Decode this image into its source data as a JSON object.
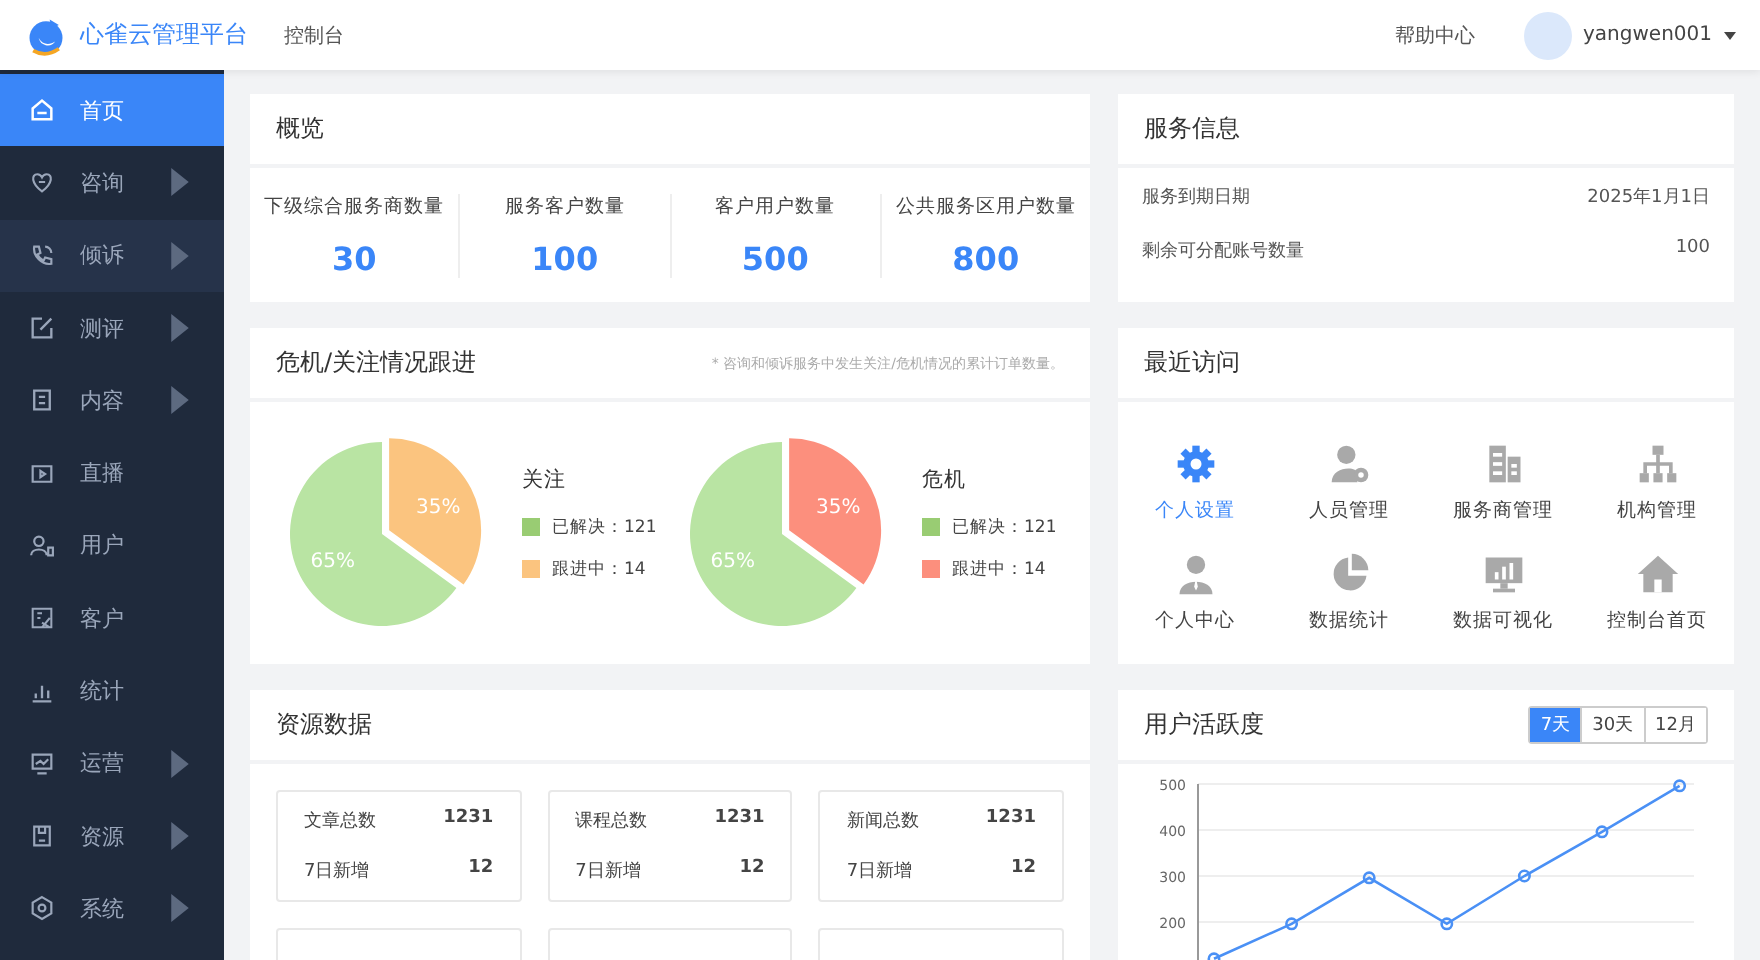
{
  "header": {
    "brand": "心雀云管理平台",
    "section": "控制台",
    "help": "帮助中心",
    "username": "yangwen001"
  },
  "sidebar": {
    "items": [
      {
        "label": "首页",
        "selected": true,
        "hovered": false,
        "has_submenu": false
      },
      {
        "label": "咨询",
        "selected": false,
        "hovered": false,
        "has_submenu": true
      },
      {
        "label": "倾诉",
        "selected": false,
        "hovered": true,
        "has_submenu": true
      },
      {
        "label": "测评",
        "selected": false,
        "hovered": false,
        "has_submenu": true
      },
      {
        "label": "内容",
        "selected": false,
        "hovered": false,
        "has_submenu": true
      },
      {
        "label": "直播",
        "selected": false,
        "hovered": false,
        "has_submenu": false
      },
      {
        "label": "用户",
        "selected": false,
        "hovered": false,
        "has_submenu": false
      },
      {
        "label": "客户",
        "selected": false,
        "hovered": false,
        "has_submenu": false
      },
      {
        "label": "统计",
        "selected": false,
        "hovered": false,
        "has_submenu": false
      },
      {
        "label": "运营",
        "selected": false,
        "hovered": false,
        "has_submenu": true
      },
      {
        "label": "资源",
        "selected": false,
        "hovered": false,
        "has_submenu": true
      },
      {
        "label": "系统",
        "selected": false,
        "hovered": false,
        "has_submenu": true
      }
    ]
  },
  "overview": {
    "title": "概览",
    "stats": [
      {
        "label": "下级综合服务商数量",
        "value": "30"
      },
      {
        "label": "服务客户数量",
        "value": "100"
      },
      {
        "label": "客户用户数量",
        "value": "500"
      },
      {
        "label": "公共服务区用户数量",
        "value": "800"
      }
    ]
  },
  "service_info": {
    "title": "服务信息",
    "rows": [
      {
        "label": "服务到期日期",
        "value": "2025年1月1日"
      },
      {
        "label": "剩余可分配账号数量",
        "value": "100"
      }
    ]
  },
  "crisis": {
    "title": "危机/关注情况跟进",
    "note": "* 咨询和倾诉服务中发生关注/危机情况的累计订单数量。",
    "pies": [
      {
        "title": "关注",
        "slices": [
          {
            "pct": "65%",
            "color": "#b9e4a3"
          },
          {
            "pct": "35%",
            "color": "#fbc47f"
          }
        ],
        "legend": [
          {
            "text": "已解决：121",
            "color": "#99cc73"
          },
          {
            "text": "跟进中：14",
            "color": "#fbc47f"
          }
        ]
      },
      {
        "title": "危机",
        "slices": [
          {
            "pct": "65%",
            "color": "#b9e4a3"
          },
          {
            "pct": "35%",
            "color": "#fc8f7d"
          }
        ],
        "legend": [
          {
            "text": "已解决：121",
            "color": "#99cc73"
          },
          {
            "text": "跟进中：14",
            "color": "#fc8f7d"
          }
        ]
      }
    ]
  },
  "recent": {
    "title": "最近访问",
    "items": [
      {
        "label": "个人设置",
        "selected": true
      },
      {
        "label": "人员管理",
        "selected": false
      },
      {
        "label": "服务商管理",
        "selected": false
      },
      {
        "label": "机构管理",
        "selected": false
      },
      {
        "label": "个人中心",
        "selected": false
      },
      {
        "label": "数据统计",
        "selected": false
      },
      {
        "label": "数据可视化",
        "selected": false
      },
      {
        "label": "控制台首页",
        "selected": false
      }
    ]
  },
  "resources": {
    "title": "资源数据",
    "cards": [
      {
        "total_label": "文章总数",
        "total": "1231",
        "new_label": "7日新增",
        "new": "12"
      },
      {
        "total_label": "课程总数",
        "total": "1231",
        "new_label": "7日新增",
        "new": "12"
      },
      {
        "total_label": "新闻总数",
        "total": "1231",
        "new_label": "7日新增",
        "new": "12"
      }
    ]
  },
  "activity": {
    "title": "用户活跃度",
    "ranges": [
      {
        "label": "7天",
        "selected": true
      },
      {
        "label": "30天",
        "selected": false
      },
      {
        "label": "12月",
        "selected": false
      }
    ],
    "chart_data": {
      "type": "line",
      "ylim": [
        0,
        500
      ],
      "yticks": [
        200,
        300,
        400,
        500
      ],
      "grid": true,
      "series": [
        {
          "color": "#4a90f5",
          "marker": "circle",
          "values": [
            120,
            196,
            296,
            196,
            300,
            396,
            496
          ]
        }
      ]
    }
  }
}
